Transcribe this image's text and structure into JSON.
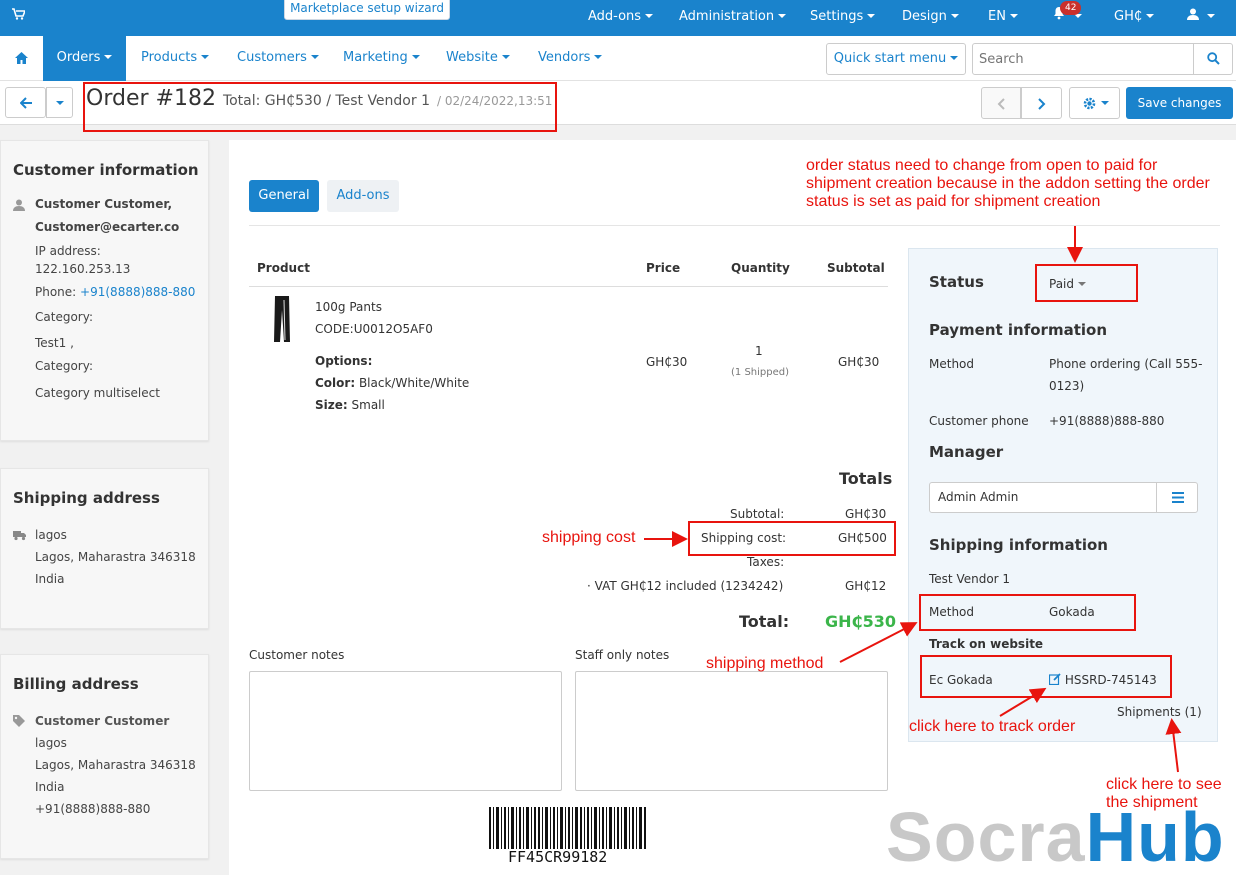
{
  "topbar": {
    "wizard": "Marketplace setup wizard",
    "addons": "Add-ons",
    "administration": "Administration",
    "settings": "Settings",
    "design": "Design",
    "language": "EN",
    "notifications_count": "42",
    "currency": "GH₵"
  },
  "nav": {
    "orders": "Orders",
    "products": "Products",
    "customers": "Customers",
    "marketing": "Marketing",
    "website": "Website",
    "vendors": "Vendors",
    "quick_start": "Quick start menu",
    "search_placeholder": "Search"
  },
  "order": {
    "title": "Order #182",
    "summary": "Total: GH₵530 / Test Vendor 1",
    "date": "/ 02/24/2022,13:51",
    "save": "Save changes"
  },
  "customer_info": {
    "heading": "Customer information",
    "name": "Customer Customer,",
    "email": "Customer@ecarter.co",
    "ip_label": "IP address:",
    "ip": "122.160.253.13",
    "phone_label": "Phone:",
    "phone": "+91(8888)888-880",
    "category_label_1": "Category:",
    "category_value_1": "Test1 ,",
    "category_label_2": "Category:",
    "category_value_2": "Category multiselect"
  },
  "shipping_address": {
    "heading": "Shipping address",
    "line1": "lagos",
    "line2": "Lagos, Maharastra 346318",
    "line3": "India"
  },
  "billing_address": {
    "heading": "Billing address",
    "name": "Customer Customer",
    "line1": "lagos",
    "line2": "Lagos, Maharastra 346318",
    "line3": "India",
    "phone": "+91(8888)888-880"
  },
  "tabs": {
    "general": "General",
    "addons": "Add-ons"
  },
  "table": {
    "headers": {
      "product": "Product",
      "price": "Price",
      "quantity": "Quantity",
      "subtotal": "Subtotal"
    },
    "row": {
      "name": "100g Pants",
      "code": "CODE:U0012O5AF0",
      "options_label": "Options:",
      "color_label": "Color:",
      "color_value": "Black/White/White",
      "size_label": "Size:",
      "size_value": "Small",
      "price": "GH₵30",
      "qty": "1",
      "shipped": "(1 Shipped)",
      "subtotal": "GH₵30"
    }
  },
  "totals": {
    "heading": "Totals",
    "subtotal_label": "Subtotal:",
    "subtotal": "GH₵30",
    "shipping_label": "Shipping cost:",
    "shipping": "GH₵500",
    "taxes_label": "Taxes:",
    "vat_label": "· VAT  GH₵12  included (1234242)",
    "vat": "GH₵12",
    "total_label": "Total:",
    "total": "GH₵530"
  },
  "notes": {
    "customer": "Customer notes",
    "staff": "Staff only notes"
  },
  "barcode": "FF45CR99182",
  "sidebar": {
    "status_heading": "Status",
    "status_value": "Paid",
    "payment_heading": "Payment information",
    "method_label": "Method",
    "method_value_1": "Phone ordering (Call 555-",
    "method_value_2": "0123)",
    "phone_label": "Customer phone",
    "phone_value": "+91(8888)888-880",
    "manager_heading": "Manager",
    "manager_value": "Admin Admin",
    "shipping_heading": "Shipping information",
    "vendor": "Test Vendor 1",
    "ship_method_label": "Method",
    "ship_method_value": "Gokada",
    "track_heading": "Track on website",
    "carrier": "Ec Gokada",
    "tracking": "HSSRD-745143",
    "shipments": "Shipments (1)"
  },
  "annotations": {
    "status_1": "order status need to change from open to paid for",
    "status_2": "shipment creation because in the addon setting the order",
    "status_3": "status is set as paid for shipment creation",
    "shipping_cost": "shipping cost",
    "shipping_method": "shipping method",
    "track": "click here to track order",
    "shipment_1": "click here to see",
    "shipment_2": "the shipment"
  },
  "watermark": {
    "part1": "Socra",
    "part2": "Hub"
  },
  "colors": {
    "accent": "#1a83cc",
    "annotation": "#e8140e",
    "total_green": "#3bb54a"
  }
}
